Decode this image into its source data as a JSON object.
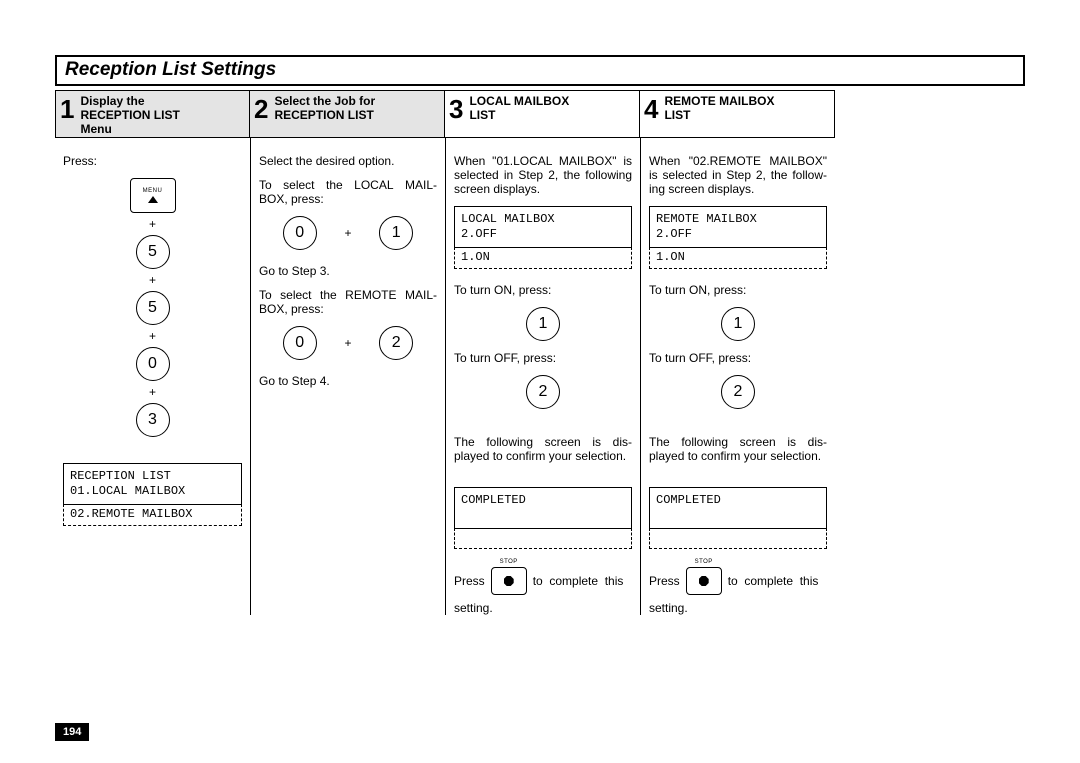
{
  "page_number": "194",
  "title": "Reception List Settings",
  "steps": {
    "1": {
      "num": "1",
      "title": "Display the RECEPTION LIST Menu"
    },
    "2": {
      "num": "2",
      "title": "Select the Job for RECEPTION LIST"
    },
    "3": {
      "num": "3",
      "title": "LOCAL MAILBOX LIST"
    },
    "4": {
      "num": "4",
      "title": "REMOTE MAILBOX LIST"
    }
  },
  "col1": {
    "press": "Press:",
    "menu_label": "MENU",
    "keys": [
      "5",
      "5",
      "0",
      "3"
    ],
    "plus": "+",
    "lcd_line1": "RECEPTION LIST",
    "lcd_line2": "01.LOCAL MAILBOX",
    "lcd_line3": "02.REMOTE MAILBOX"
  },
  "col2": {
    "line1": "Select the desired option.",
    "line2": "To select the LOCAL MAIL-BOX, press:",
    "key0": "0",
    "key1": "1",
    "line3": "Go to Step 3.",
    "line4": "To select the REMOTE MAIL-BOX, press:",
    "key2": "2",
    "line5": "Go to Step 4."
  },
  "col3": {
    "intro": "When \"01.LOCAL MAILBOX\" is selected in Step 2, the following screen displays.",
    "lcd1": "LOCAL MAILBOX",
    "lcd2": "2.OFF",
    "lcd3": "1.ON",
    "turn_on": "To turn ON, press:",
    "key_on": "1",
    "turn_off": "To turn OFF, press:",
    "key_off": "2",
    "confirm": "The following screen is dis-played to confirm your selection.",
    "completed": "COMPLETED",
    "press_pre": "Press",
    "press_post": "to complete this",
    "press_last": "setting.",
    "stop": "STOP"
  },
  "col4": {
    "intro": "When \"02.REMOTE MAILBOX\" is selected in Step 2, the follow-ing screen displays.",
    "lcd1": "REMOTE MAILBOX",
    "lcd2": "2.OFF",
    "lcd3": "1.ON",
    "turn_on": "To turn ON, press:",
    "key_on": "1",
    "turn_off": "To turn OFF, press:",
    "key_off": "2",
    "confirm": "The following screen is dis-played to confirm your selection.",
    "completed": "COMPLETED",
    "press_pre": "Press",
    "press_post": "to complete this",
    "press_last": "setting.",
    "stop": "STOP"
  }
}
